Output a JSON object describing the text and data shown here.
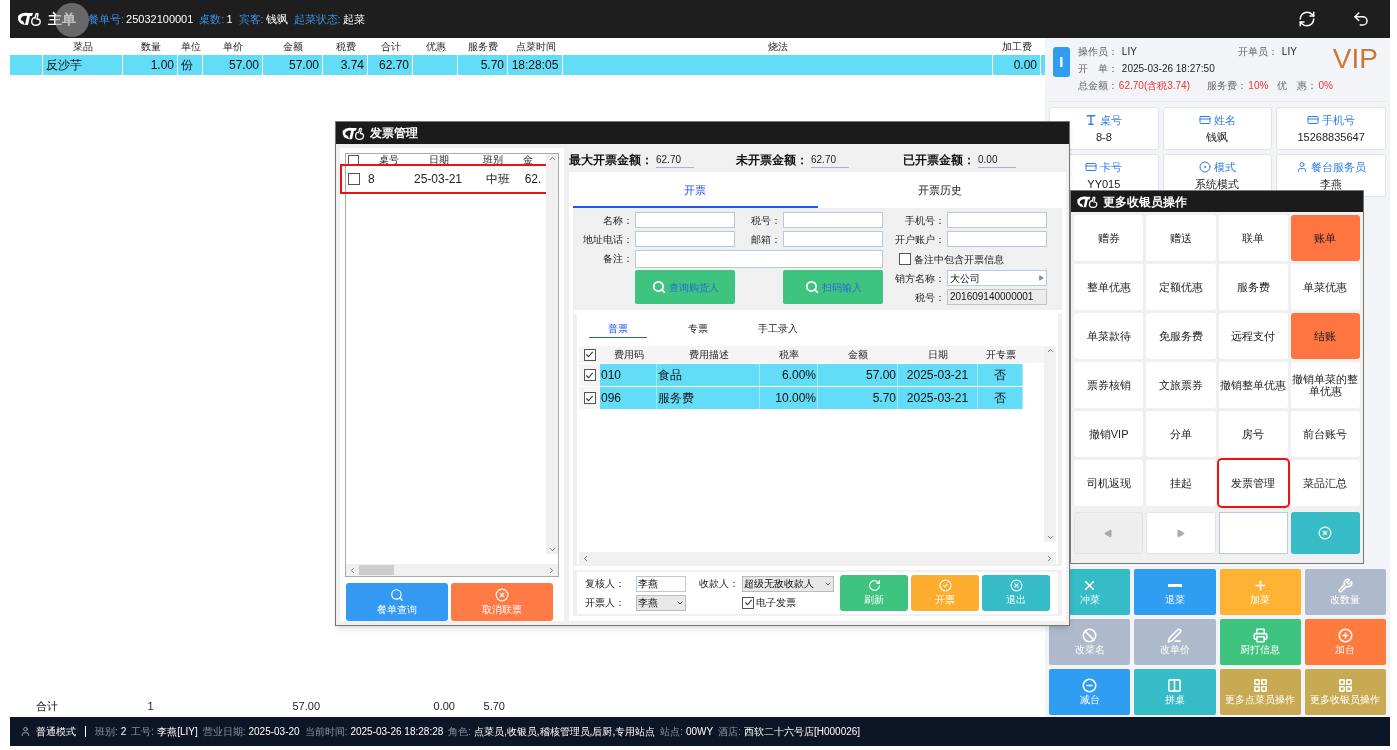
{
  "top_bar": {
    "avatar_hint": "主单",
    "fields": [
      {
        "label": "餐单号:",
        "value": "25032100001"
      },
      {
        "label": "桌数:",
        "value": "1"
      },
      {
        "label": "宾客:",
        "value": "钱飒"
      },
      {
        "label": "起菜状态:",
        "value": "起菜"
      }
    ]
  },
  "order_table": {
    "columns": [
      "菜品",
      "数量",
      "单位",
      "单价",
      "金额",
      "税费",
      "合计",
      "优惠",
      "服务费",
      "点菜时间",
      "烧法",
      "加工费"
    ],
    "rows": [
      {
        "selected": true,
        "cells": [
          "反沙芋",
          "1.00",
          "份",
          "57.00",
          "57.00",
          "3.74",
          "62.70",
          null,
          "5.70",
          "18:28:05",
          null,
          "0.00"
        ]
      }
    ],
    "totals": {
      "label": "合计",
      "values": [
        "1",
        "57.00",
        "0.00",
        "5.70"
      ]
    }
  },
  "session": {
    "avatar_letter": "I",
    "badge": "VIP",
    "info": [
      {
        "label": "操作员：",
        "value": "LIY",
        "alert": false
      },
      {
        "label": "开单员：",
        "value": "LIY",
        "alert": false
      },
      {
        "label": "开　单：",
        "value": "2025-03-26 18:27:50",
        "alert": false
      },
      {
        "label": "总金额：",
        "value": "62.70(含税3.74)",
        "alert": true
      },
      {
        "label": "服务费：",
        "value": "10%",
        "alert": true
      },
      {
        "label": "优　惠：",
        "value": "0%",
        "alert": true
      }
    ],
    "tiles": [
      {
        "label": "桌号",
        "value": "8-8"
      },
      {
        "label": "姓名",
        "value": "钱飒"
      },
      {
        "label": "手机号",
        "value": "15268835647"
      },
      {
        "label": "卡号",
        "value": "YY015"
      },
      {
        "label": "模式",
        "value": "系统模式"
      },
      {
        "label": "餐台服务员",
        "value": "李燕"
      }
    ]
  },
  "actions": [
    {
      "label": "冲菜",
      "color": "#35bcc6"
    },
    {
      "label": "退菜",
      "color": "#2f9df2"
    },
    {
      "label": "加菜",
      "color": "#fdb233"
    },
    {
      "label": "改数量",
      "color": "#aebacb"
    },
    {
      "label": "改菜名",
      "color": "#aebacb"
    },
    {
      "label": "改单价",
      "color": "#aebacb"
    },
    {
      "label": "厨打信息",
      "color": "#3ec47f"
    },
    {
      "label": "加台",
      "color": "#ff7a3d"
    },
    {
      "label": "减台",
      "color": "#2f9df2"
    },
    {
      "label": "拼桌",
      "color": "#35bcc6"
    },
    {
      "label": "更多点菜员操作",
      "color": "#c8aa55"
    },
    {
      "label": "更多收银员操作",
      "color": "#c8aa55"
    }
  ],
  "status_bar": {
    "mode": "普通模式",
    "fields": [
      {
        "label": "班别:",
        "value": "2"
      },
      {
        "label": "工号:",
        "value": "李燕[LIY]"
      },
      {
        "label": "营业日期:",
        "value": "2025-03-20"
      },
      {
        "label": "当前时间:",
        "value": "2025-03-26 18:28:28"
      },
      {
        "label": "角色:",
        "value": "点菜员,收银员,稽核管理员,后厨,专用站点"
      },
      {
        "label": "站点:",
        "value": "00WY"
      },
      {
        "label": "酒店:",
        "value": "西软二十六号店[H000026]"
      }
    ]
  },
  "invoice_dialog": {
    "title": "发票管理",
    "bill_list": {
      "all_checked": false,
      "columns": [
        "桌号",
        "日期",
        "班别",
        "金"
      ],
      "rows": [
        {
          "checked": false,
          "highlighted": true,
          "cells": [
            "8",
            "25-03-21",
            "中班",
            "62."
          ]
        }
      ]
    },
    "list_buttons": [
      {
        "label": "餐单查询",
        "color": "#3399f3"
      },
      {
        "label": "取消联票",
        "color": "#ff7a45"
      }
    ],
    "amounts": [
      {
        "label": "最大开票金额：",
        "value": "62.70"
      },
      {
        "label": "未开票金额：",
        "value": "62.70"
      },
      {
        "label": "已开票金额：",
        "value": "0.00"
      }
    ],
    "tabs": [
      {
        "label": "开票",
        "selected": true
      },
      {
        "label": "开票历史",
        "selected": false
      }
    ],
    "fields": [
      {
        "label": "名称："
      },
      {
        "label": "税号："
      },
      {
        "label": "手机号："
      },
      {
        "label": "地址电话："
      },
      {
        "label": "邮箱："
      },
      {
        "label": "开户账户："
      },
      {
        "label": "备注："
      }
    ],
    "remark_option": {
      "label": "备注中包含开票信息",
      "checked": false
    },
    "search_buttons": [
      {
        "label": "查询购货人"
      },
      {
        "label": "扫码输入"
      }
    ],
    "seller": {
      "label": "销方名称：",
      "value": "大公司"
    },
    "seller_tax": {
      "label": "税号：",
      "value": "201609140000001"
    },
    "invoice_types": [
      {
        "label": "普票",
        "selected": true
      },
      {
        "label": "专票",
        "selected": false
      },
      {
        "label": "手工录入",
        "selected": false
      }
    ],
    "items": {
      "all_checked": true,
      "columns": [
        "费用码",
        "费用描述",
        "税率",
        "金额",
        "日期",
        "开专票"
      ],
      "rows": [
        {
          "checked": true,
          "cells": [
            "010",
            "食品",
            "6.00%",
            "57.00",
            "2025-03-21",
            "否"
          ]
        },
        {
          "checked": true,
          "cells": [
            "096",
            "服务费",
            "10.00%",
            "5.70",
            "2025-03-21",
            "否"
          ]
        }
      ]
    },
    "reviewer": {
      "label": "复核人：",
      "value": "李燕"
    },
    "payee": {
      "label": "收款人：",
      "value": "超级无敌收款人"
    },
    "issuer": {
      "label": "开票人：",
      "value": "李燕"
    },
    "e_invoice": {
      "label": "电子发票",
      "checked": true
    },
    "footer_buttons": [
      {
        "label": "刷新",
        "color": "#3ec47f"
      },
      {
        "label": "开票",
        "color": "#fdae2e"
      },
      {
        "label": "退出",
        "color": "#35bcc6"
      }
    ]
  },
  "cashier_popup": {
    "title": "更多收银员操作",
    "buttons": [
      {
        "label": "赠券",
        "color": "#ffffff",
        "highlighted": false
      },
      {
        "label": "赠送",
        "color": "#ffffff",
        "highlighted": false
      },
      {
        "label": "联单",
        "color": "#ffffff",
        "highlighted": false
      },
      {
        "label": "账单",
        "color": "#ff7542",
        "highlighted": false
      },
      {
        "label": "整单优惠",
        "color": "#ffffff",
        "highlighted": false
      },
      {
        "label": "定额优惠",
        "color": "#ffffff",
        "highlighted": false
      },
      {
        "label": "服务费",
        "color": "#ffffff",
        "highlighted": false
      },
      {
        "label": "单菜优惠",
        "color": "#ffffff",
        "highlighted": false
      },
      {
        "label": "单菜款待",
        "color": "#ffffff",
        "highlighted": false
      },
      {
        "label": "免服务费",
        "color": "#ffffff",
        "highlighted": false
      },
      {
        "label": "远程支付",
        "color": "#ffffff",
        "highlighted": false
      },
      {
        "label": "结账",
        "color": "#ff7542",
        "highlighted": false
      },
      {
        "label": "票券核销",
        "color": "#ffffff",
        "highlighted": false
      },
      {
        "label": "文旅票券",
        "color": "#ffffff",
        "highlighted": false
      },
      {
        "label": "撤销整单优惠",
        "color": "#ffffff",
        "highlighted": false
      },
      {
        "label": "撤销单菜的整单优惠",
        "color": "#ffffff",
        "highlighted": false
      },
      {
        "label": "撤销VIP",
        "color": "#ffffff",
        "highlighted": false
      },
      {
        "label": "分单",
        "color": "#ffffff",
        "highlighted": false
      },
      {
        "label": "房号",
        "color": "#ffffff",
        "highlighted": false
      },
      {
        "label": "前台账号",
        "color": "#ffffff",
        "highlighted": false
      },
      {
        "label": "司机返现",
        "color": "#ffffff",
        "highlighted": false
      },
      {
        "label": "挂起",
        "color": "#ffffff",
        "highlighted": false
      },
      {
        "label": "发票管理",
        "color": "#ffffff",
        "highlighted": true
      },
      {
        "label": "菜品汇总",
        "color": "#ffffff",
        "highlighted": false
      }
    ]
  }
}
